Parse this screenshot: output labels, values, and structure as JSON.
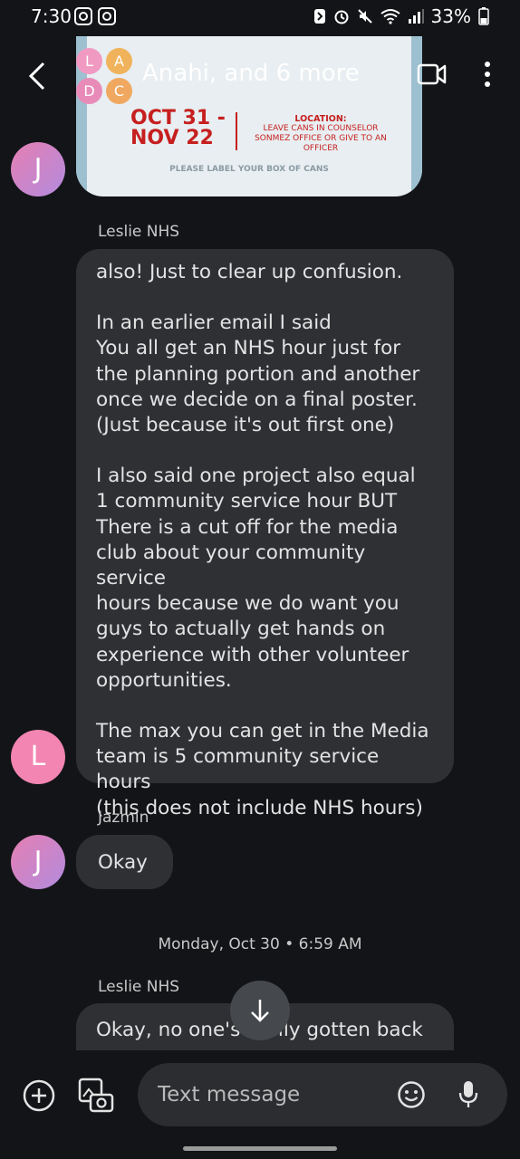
{
  "status": {
    "time": "7:30",
    "battery": "33%"
  },
  "header": {
    "title": "Anahi, and 6 more",
    "avatar_letters": [
      "L",
      "A",
      "D",
      "C"
    ]
  },
  "poster": {
    "dates": [
      "OCT 31 -",
      "NOV 22"
    ],
    "location_title": "LOCATION:",
    "location_text": "LEAVE CANS IN COUNSELOR SONMEZ OFFICE OR GIVE TO AN OFFICER",
    "label": "PLEASE LABEL YOUR BOX OF CANS"
  },
  "messages": [
    {
      "sender": "Leslie NHS",
      "avatar": "L",
      "lines_a": [
        "also! Just to clear up confusion."
      ],
      "lines_b": [
        "In an earlier email I said",
        "You all get an NHS hour just for",
        "the planning portion and another",
        "once we decide on a final poster.",
        "(Just because it's out first one)"
      ],
      "lines_c": [
        "I also said one project also equal",
        "1 community service hour BUT",
        "There is a cut off for the media",
        "club about your community service",
        "hours because we do want you",
        "guys to actually get hands on",
        "experience with other volunteer",
        "opportunities."
      ],
      "lines_d": [
        "The max you can get in the Media",
        "team is 5 community service hours",
        "(this does not include NHS hours)"
      ]
    },
    {
      "sender": "Jazmin",
      "avatar": "J",
      "text": "Okay"
    }
  ],
  "date_separator": "Monday, Oct 30 • 6:59 AM",
  "last_message": {
    "sender": "Leslie NHS",
    "visible_text": "Okay, no one's really gotten back"
  },
  "prev_avatar": "J",
  "composer": {
    "placeholder": "Text message"
  }
}
